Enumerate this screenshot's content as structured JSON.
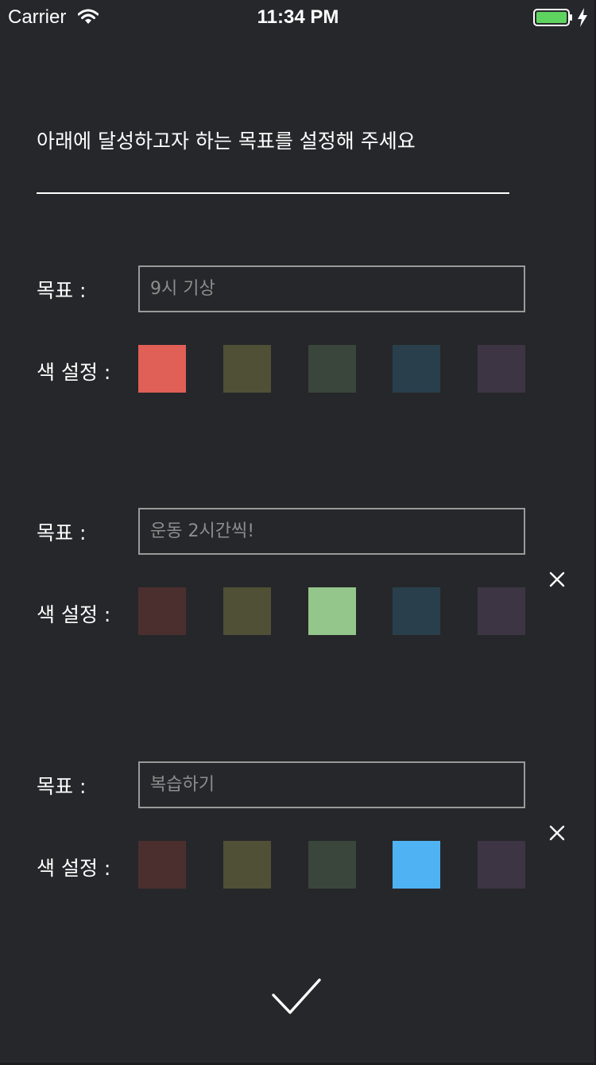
{
  "status_bar": {
    "carrier": "Carrier",
    "time": "11:34 PM",
    "battery_color": "#5fd35f"
  },
  "instruction": "아래에 달성하고자 하는 목표를 설정해 주세요",
  "goals": [
    {
      "goal_label": "목표 :",
      "color_label": "색 설정 :",
      "placeholder": "9시 기상",
      "value": "",
      "has_delete": false,
      "selected_index": 0,
      "swatches": [
        "#e05f57",
        "#4f5035",
        "#3a463b",
        "#29404c",
        "#3d3444"
      ]
    },
    {
      "goal_label": "목표 :",
      "color_label": "색 설정 :",
      "placeholder": "운동 2시간씩!",
      "value": "",
      "has_delete": true,
      "selected_index": 2,
      "swatches": [
        "#4b2f2f",
        "#4f5035",
        "#94c68c",
        "#29404c",
        "#3d3444"
      ]
    },
    {
      "goal_label": "목표 :",
      "color_label": "색 설정 :",
      "placeholder": "복습하기",
      "value": "",
      "has_delete": true,
      "selected_index": 3,
      "swatches": [
        "#4b2f2f",
        "#4f5035",
        "#3a463b",
        "#4fb3f3",
        "#3d3444"
      ]
    }
  ],
  "icons": {
    "wifi": "wifi-icon",
    "battery": "battery-icon",
    "charging": "charging-bolt-icon",
    "delete": "close-icon",
    "confirm": "checkmark-icon"
  }
}
